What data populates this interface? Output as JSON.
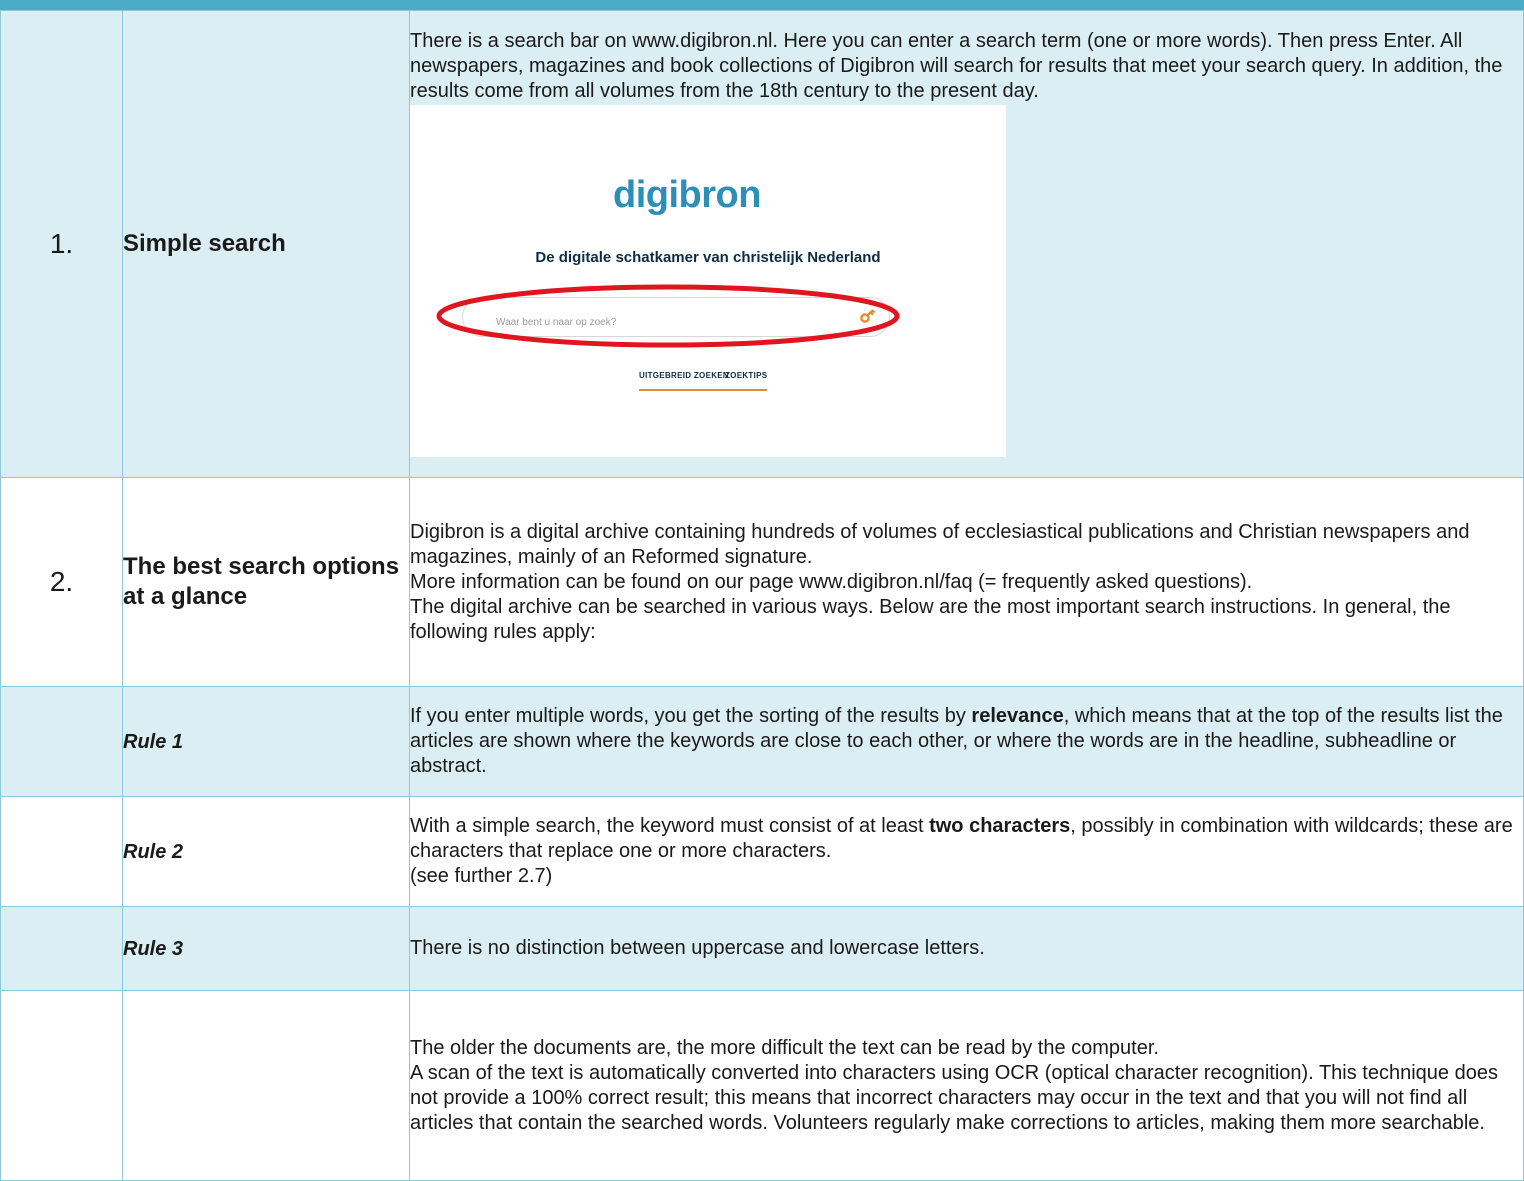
{
  "rows": [
    {
      "num": "1.",
      "label": "Simple search",
      "content": "There is a search bar on www.digibron.nl. Here you can enter a search term (one or more words). Then press Enter. All newspapers, magazines and book collections of Digibron will search for results that meet your search query. In addition, the results come from all volumes from the 18th century to the present day."
    },
    {
      "num": "2.",
      "label": "The best search options at a glance",
      "paragraphs": [
        "Digibron is a digital archive containing hundreds of volumes of ecclesiastical publications and Christian newspapers and magazines, mainly of an Reformed signature.",
        "More information can be found on our page www.digibron.nl/faq (= frequently asked questions).",
        "The digital archive can be searched in various ways. Below are the most important search instructions. In general, the following rules apply:"
      ]
    },
    {
      "label": "Rule 1",
      "before": "If you enter multiple words, you get the sorting of the results by ",
      "bold": "relevance",
      "after": ", which means that at the top of the results list the articles are shown where the keywords are close to each other, or where the words are in the headline, subheadline or abstract."
    },
    {
      "label": "Rule 2",
      "before": "With a simple search, the keyword must consist of at least ",
      "bold": "two characters",
      "after": ", possibly in combination with wildcards; these are characters that replace one or more characters.",
      "extra": "(see further 2.7)"
    },
    {
      "label": "Rule 3",
      "content": "There is no distinction between uppercase and lowercase letters."
    },
    {
      "paragraphs": [
        "The older the documents are, the more difficult the text can be read by the computer.",
        "A scan of the text is automatically converted into characters using OCR (optical character recognition). This technique does not provide a 100% correct result; this means that incorrect characters may occur in the text and that you will not find all articles that contain the searched words. Volunteers regularly make corrections to articles, making them more searchable."
      ]
    }
  ],
  "screenshot": {
    "logo": "digibron",
    "tagline": "De digitale schatkamer van christelijk Nederland",
    "search_placeholder": "Waar bent u naar op zoek?",
    "link_advanced": "UITGEBREID ZOEKEN",
    "link_tips": "ZOEKTIPS",
    "colors": {
      "brand": "#2c8fb8",
      "highlight": "#e0151f",
      "accent": "#e38c2e",
      "header_bar": "#4aacc6",
      "row_shade": "#daeef3"
    },
    "icons": [
      "key-icon"
    ]
  }
}
